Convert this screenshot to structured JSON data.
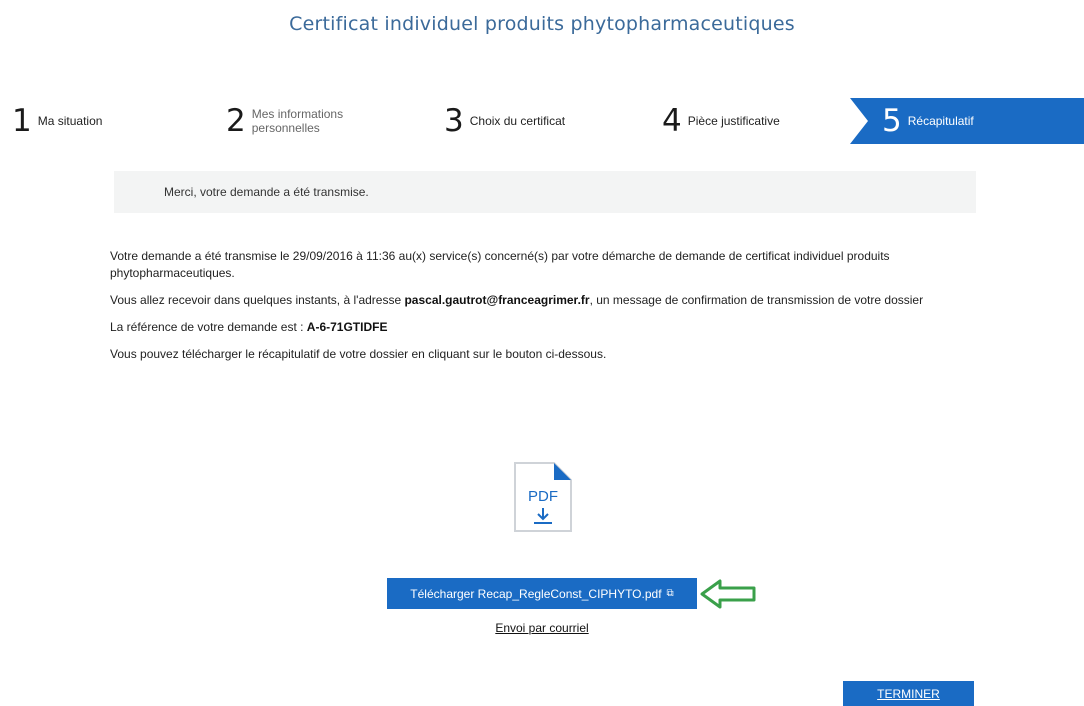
{
  "header": {
    "title": "Certificat individuel produits phytopharmaceutiques"
  },
  "stepper": {
    "steps": [
      {
        "number": "1",
        "label_line1": "Ma situation",
        "label_line2": ""
      },
      {
        "number": "2",
        "label_line1": "Mes informations",
        "label_line2": "personnelles"
      },
      {
        "number": "3",
        "label_line1": "Choix du certificat",
        "label_line2": ""
      },
      {
        "number": "4",
        "label_line1": "Pièce justificative",
        "label_line2": ""
      },
      {
        "number": "5",
        "label_line1": "Récapitulatif",
        "label_line2": ""
      }
    ],
    "active_step": 5
  },
  "notice": {
    "text": "Merci, votre demande a été transmise."
  },
  "content": {
    "p1": "Votre demande a été transmise le 29/09/2016 à 11:36 au(x) service(s) concerné(s) par votre démarche de demande de certificat individuel produits phytopharmaceutiques.",
    "p2_before": "Vous allez recevoir dans quelques instants, à l'adresse ",
    "p2_email": "pascal.gautrot@franceagrimer.fr",
    "p2_after": ", un message de confirmation de transmission de votre dossier",
    "p3_label": "La référence de votre demande est : ",
    "p3_reference": "A-6-71GTIDFE",
    "p4": "Vous pouvez télécharger le récapitulatif de votre dossier en cliquant sur le bouton ci-dessous."
  },
  "pdf_icon": {
    "label": "PDF",
    "icon": "pdf-download-icon"
  },
  "download_button": {
    "label": "Télécharger Recap_RegleConst_CIPHYTO.pdf",
    "icon": "external-link-icon"
  },
  "annotation": {
    "icon": "arrow-left-icon",
    "color": "#3aa04a"
  },
  "mail_link": {
    "label": "Envoi par courriel"
  },
  "finish_button": {
    "label": "TERMINER"
  },
  "colors": {
    "accent": "#1a6bc4",
    "title": "#3b6a9a",
    "notice_bg": "#f3f4f4"
  }
}
